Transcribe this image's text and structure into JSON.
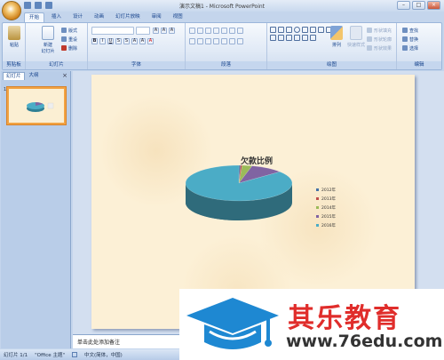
{
  "window": {
    "title": "演示文稿1 - Microsoft PowerPoint",
    "buttons": {
      "minimize": "–",
      "maximize": "□",
      "close": "×"
    }
  },
  "ribbon": {
    "tabs": [
      {
        "label": "开始",
        "active": true
      },
      {
        "label": "插入"
      },
      {
        "label": "设计"
      },
      {
        "label": "动画"
      },
      {
        "label": "幻灯片放映"
      },
      {
        "label": "审阅"
      },
      {
        "label": "视图"
      }
    ],
    "groups": {
      "clipboard": {
        "label": "剪贴板",
        "paste": "粘贴"
      },
      "slides": {
        "label": "幻灯片",
        "new_slide": "新建\n幻灯片",
        "layout": "版式",
        "reset": "重设",
        "delete": "删除"
      },
      "font": {
        "label": "字体"
      },
      "paragraph": {
        "label": "段落"
      },
      "drawing": {
        "label": "绘图",
        "arrange": "排列",
        "quick_styles": "快速样式",
        "shape_fill": "形状填充",
        "shape_outline": "形状轮廓",
        "shape_effects": "形状效果"
      },
      "editing": {
        "label": "编辑",
        "find": "查找",
        "replace": "替换",
        "select": "选择"
      }
    }
  },
  "left_pane": {
    "tabs": [
      {
        "label": "幻灯片",
        "active": true
      },
      {
        "label": "大纲"
      }
    ],
    "close": "×",
    "slide_number": "1"
  },
  "slide": {
    "chart_data": {
      "type": "pie",
      "title": "欠款比例",
      "categories": [
        "2012年",
        "2013年",
        "2014年",
        "2015年",
        "2016年"
      ],
      "values": [
        0.5,
        0.5,
        3,
        10,
        86
      ],
      "colors": [
        "#4572a7",
        "#c0504d",
        "#9bbb59",
        "#8064a2",
        "#4bacc6"
      ],
      "legend_position": "right",
      "style": "3d"
    }
  },
  "notes": {
    "placeholder": "单击此处添加备注"
  },
  "status": {
    "slide": "幻灯片 1/1",
    "theme": "\"Office 主题\"",
    "language": "中文(简体，中国)"
  },
  "watermark": {
    "brand": "其乐教育",
    "url": "www.76edu.com"
  }
}
